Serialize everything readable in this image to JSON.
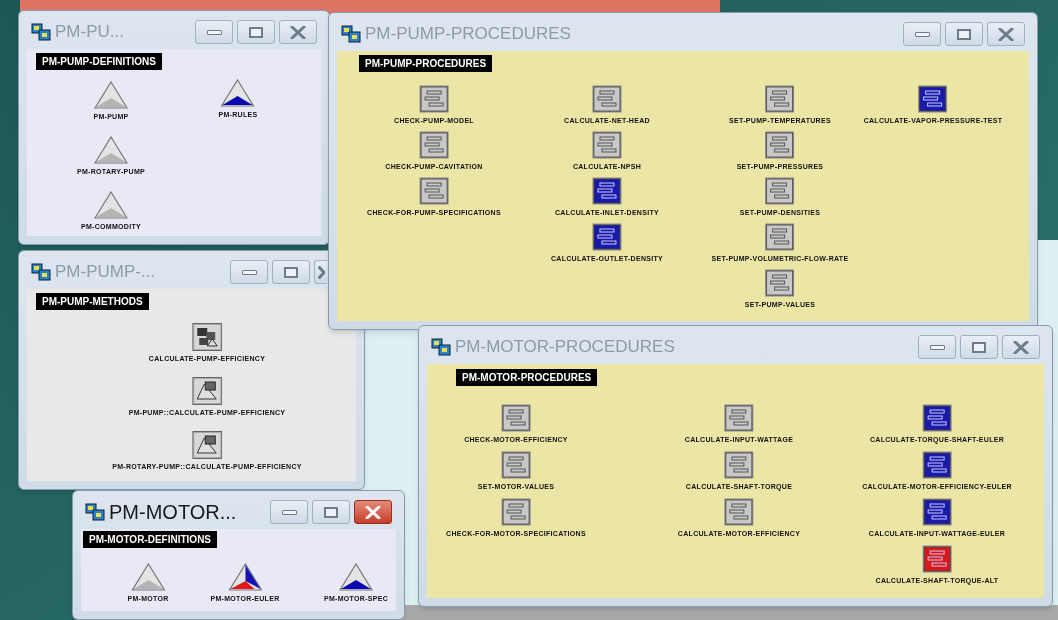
{
  "windows": [
    {
      "title": "PM-PU...",
      "active": false,
      "workspace": {
        "label": "PM-PUMP-DEFINITIONS",
        "columns": [
          [
            {
              "kind": "class",
              "color": "#b4b4b4",
              "name": "PM-PUMP"
            },
            {
              "kind": "class",
              "color": "#b4b4b4",
              "name": "PM-ROTARY-PUMP"
            },
            {
              "kind": "class",
              "color": "#b4b4b4",
              "name": "PM-COMMODITY"
            }
          ],
          [
            {
              "kind": "class",
              "color": "#0a0ab4",
              "name": "PM-RULES"
            }
          ]
        ]
      }
    },
    {
      "title": "PM-PUMP-PROCEDURES",
      "active": false,
      "workspace": {
        "label": "PM-PUMP-PROCEDURES",
        "columns": [
          [
            {
              "kind": "procedure",
              "color": "#c8c8c8",
              "name": "CHECK-PUMP-MODEL"
            },
            {
              "kind": "procedure",
              "color": "#c8c8c8",
              "name": "CHECK-PUMP-CAVITATION"
            },
            {
              "kind": "procedure",
              "color": "#c8c8c8",
              "name": "CHECK-FOR-PUMP-SPECIFICATIONS"
            }
          ],
          [
            {
              "kind": "procedure",
              "color": "#c8c8c8",
              "name": "CALCULATE-NET-HEAD"
            },
            {
              "kind": "procedure",
              "color": "#c8c8c8",
              "name": "CALCULATE-NPSH"
            },
            {
              "kind": "procedure",
              "color": "#1a1aa8",
              "name": "CALCULATE-INLET-DENSITY"
            },
            {
              "kind": "procedure",
              "color": "#1a1aa8",
              "name": "CALCULATE-OUTLET-DENSITY"
            }
          ],
          [
            {
              "kind": "procedure",
              "color": "#c8c8c8",
              "name": "SET-PUMP-TEMPERATURES"
            },
            {
              "kind": "procedure",
              "color": "#c8c8c8",
              "name": "SET-PUMP-PRESSURES"
            },
            {
              "kind": "procedure",
              "color": "#c8c8c8",
              "name": "SET-PUMP-DENSITIES"
            },
            {
              "kind": "procedure",
              "color": "#c8c8c8",
              "name": "SET-PUMP-VOLUMETRIC-FLOW-RATE"
            },
            {
              "kind": "procedure",
              "color": "#c8c8c8",
              "name": "SET-PUMP-VALUES"
            }
          ],
          [
            {
              "kind": "procedure",
              "color": "#1a1aa8",
              "name": "CALCULATE-VAPOR-PRESSURE-TEST"
            }
          ]
        ]
      }
    },
    {
      "title": "PM-PUMP-...",
      "active": false,
      "workspace": {
        "label": "PM-PUMP-METHODS",
        "columns": [
          [
            {
              "kind": "method-group",
              "name": "CALCULATE-PUMP-EFFICIENCY"
            },
            {
              "kind": "method",
              "name": "PM-PUMP::CALCULATE-PUMP-EFFICIENCY"
            },
            {
              "kind": "method",
              "name": "PM-ROTARY-PUMP::CALCULATE-PUMP-EFFICIENCY"
            }
          ]
        ]
      }
    },
    {
      "title": "PM-MOTOR-PROCEDURES",
      "active": false,
      "workspace": {
        "label": "PM-MOTOR-PROCEDURES",
        "columns": [
          [
            {
              "kind": "procedure",
              "color": "#c8c8c8",
              "name": "CHECK-MOTOR-EFFICIENCY"
            },
            {
              "kind": "procedure",
              "color": "#c8c8c8",
              "name": "SET-MOTOR-VALUES"
            },
            {
              "kind": "procedure",
              "color": "#c8c8c8",
              "name": "CHECK-FOR-MOTOR-SPECIFICATIONS"
            }
          ],
          [
            {
              "kind": "procedure",
              "color": "#c8c8c8",
              "name": "CALCULATE-INPUT-WATTAGE"
            },
            {
              "kind": "procedure",
              "color": "#c8c8c8",
              "name": "CALCULATE-SHAFT-TORQUE"
            },
            {
              "kind": "procedure",
              "color": "#c8c8c8",
              "name": "CALCULATE-MOTOR-EFFICIENCY"
            }
          ],
          [
            {
              "kind": "procedure",
              "color": "#1a1aa8",
              "name": "CALCULATE-TORQUE-SHAFT-EULER"
            },
            {
              "kind": "procedure",
              "color": "#1a1aa8",
              "name": "CALCULATE-MOTOR-EFFICIENCY-EULER"
            },
            {
              "kind": "procedure",
              "color": "#1a1aa8",
              "name": "CALCULATE-INPUT-WATTAGE-EULER"
            },
            {
              "kind": "procedure",
              "color": "#d81818",
              "name": "CALCULATE-SHAFT-TORQUE-ALT"
            }
          ]
        ]
      }
    },
    {
      "title": "PM-MOTOR...",
      "active": true,
      "workspace": {
        "label": "PM-MOTOR-DEFINITIONS",
        "columns": [
          [
            {
              "kind": "class",
              "color": "#b4b4b4",
              "name": "PM-MOTOR"
            }
          ],
          [
            {
              "kind": "split",
              "color": "#1414b4",
              "name": "PM-MOTOR-EULER"
            }
          ],
          [
            {
              "kind": "class",
              "color": "#0a0ab4",
              "name": "PM-MOTOR-SPEC"
            }
          ]
        ]
      }
    }
  ]
}
